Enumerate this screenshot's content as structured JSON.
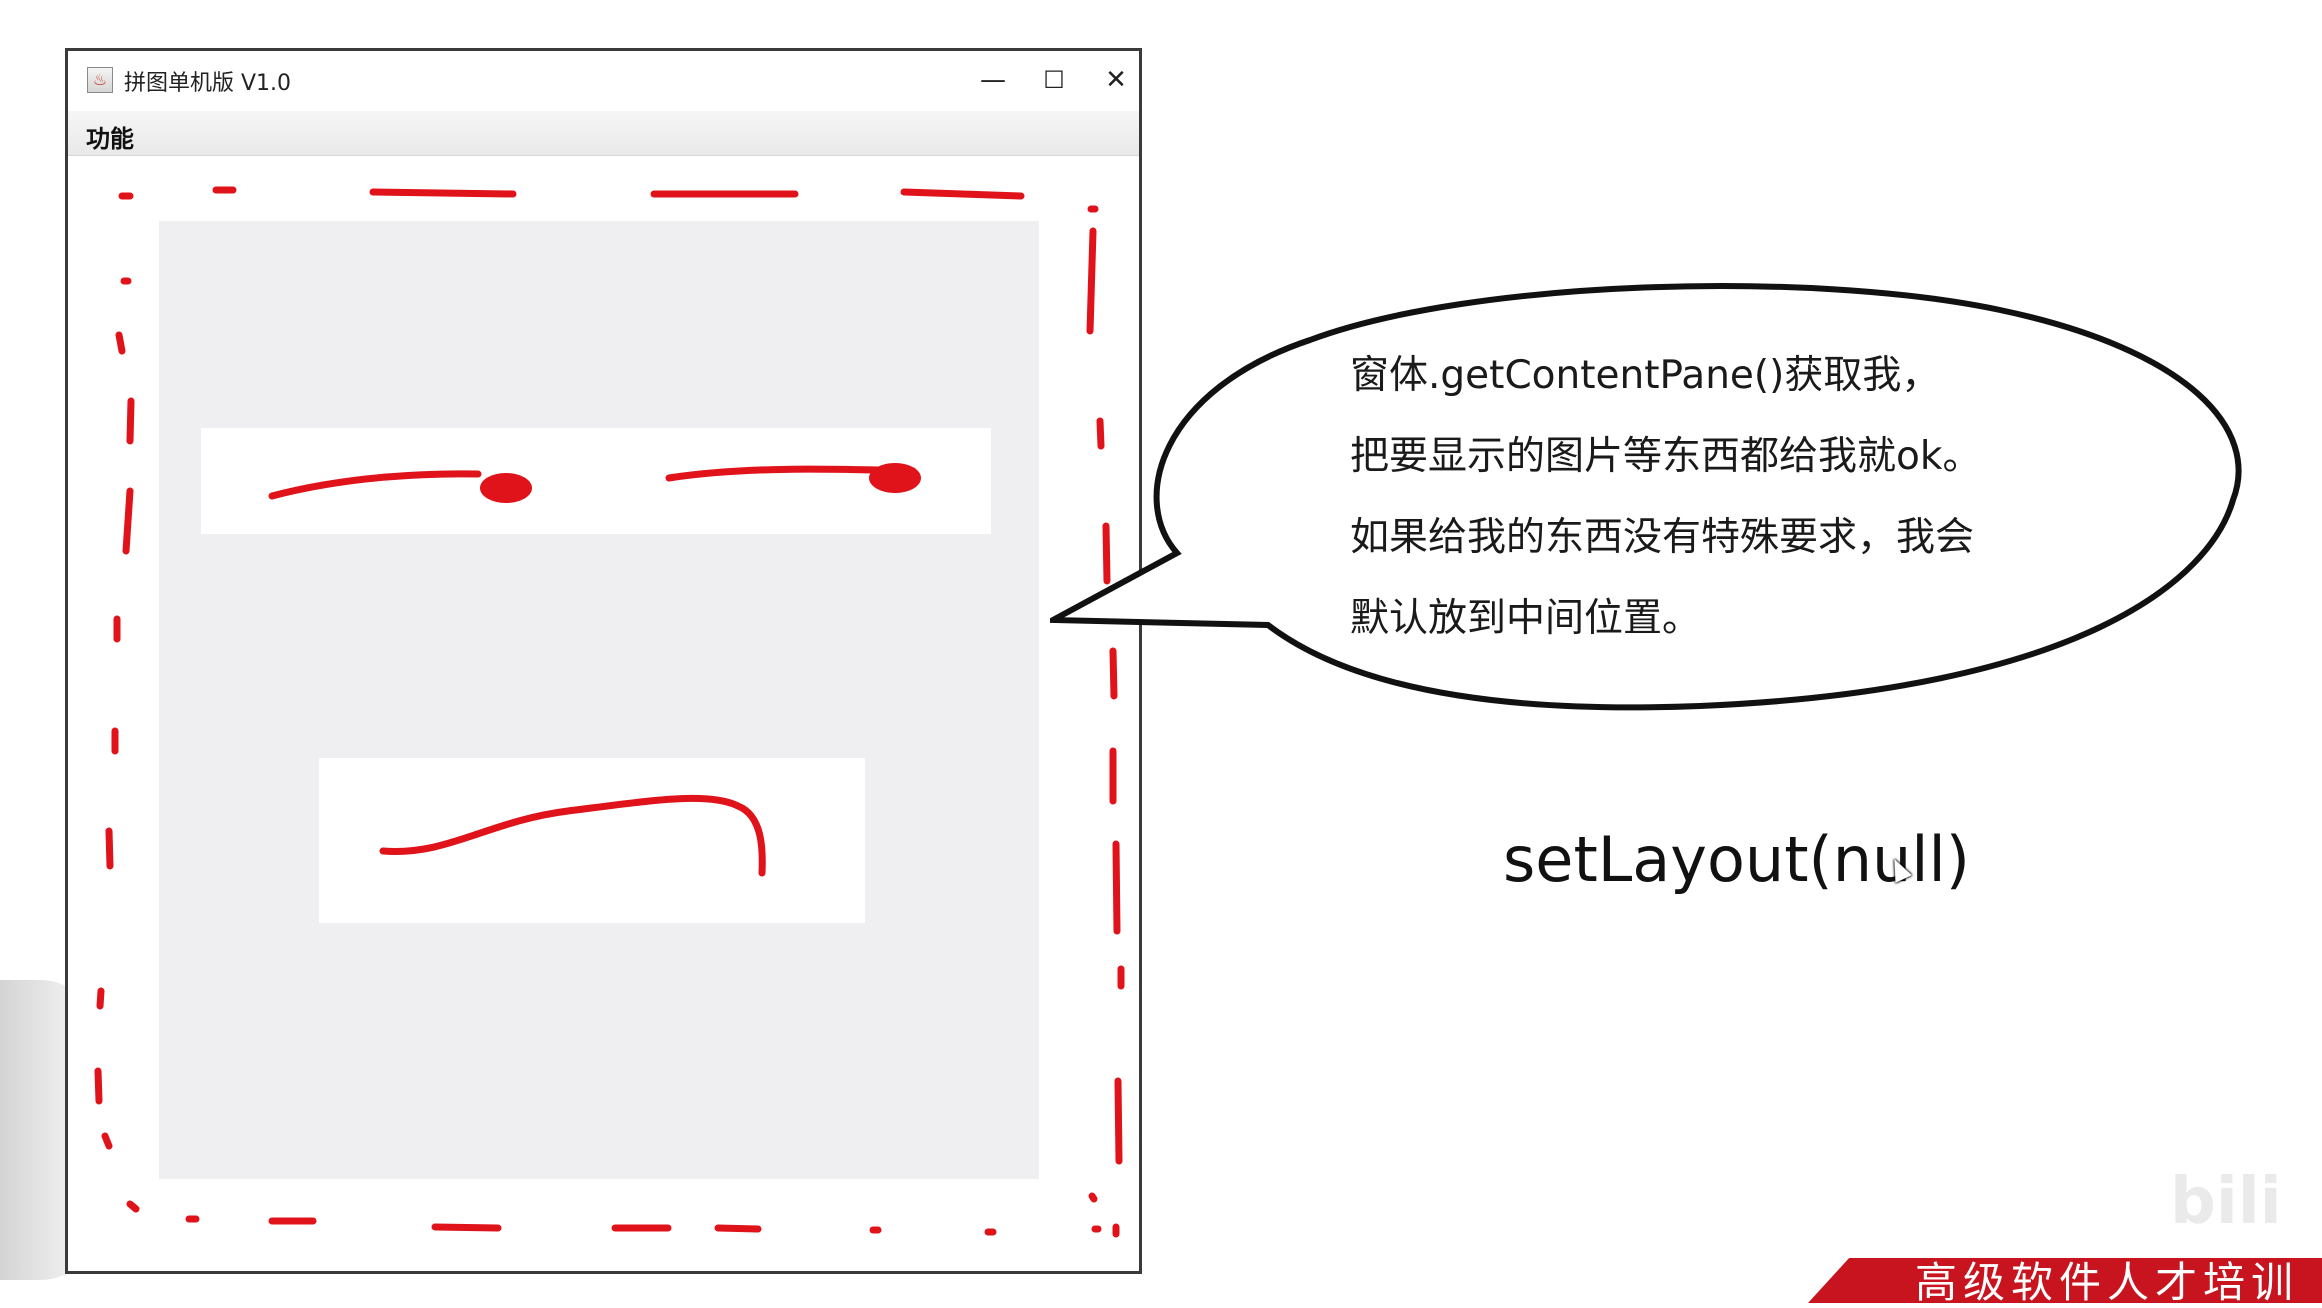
{
  "window": {
    "title": "拼图单机版 V1.0",
    "menu": {
      "items": [
        "功能"
      ]
    },
    "controls": {
      "minimize": "—",
      "maximize": "☐",
      "close": "✕"
    }
  },
  "annotation": {
    "bubble_lines": [
      "窗体.getContentPane()获取我，",
      "把要显示的图片等东西都给我就ok。",
      "如果给我的东西没有特殊要求，我会",
      "默认放到中间位置。"
    ],
    "code": "setLayout(null)"
  },
  "banner": {
    "text": "高级软件人才培训"
  },
  "watermark": "bili",
  "colors": {
    "ink": "#e0121a",
    "pane": "#efeff1"
  }
}
